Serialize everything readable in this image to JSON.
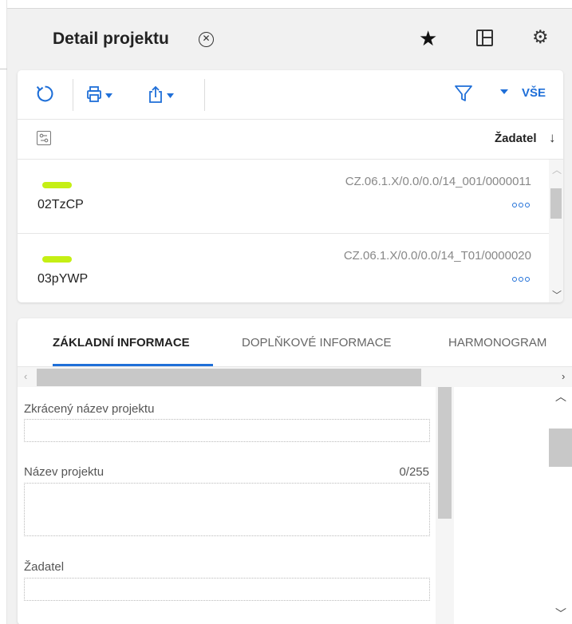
{
  "header": {
    "title": "Detail projektu",
    "close_icon": "close-circle-icon",
    "star_icon": "star-icon",
    "layout_icon": "layout-icon",
    "settings_icon": "gear-icon"
  },
  "toolbar": {
    "refresh_icon": "refresh-icon",
    "print_icon": "print-icon",
    "export_icon": "share-icon",
    "filter_icon": "filter-icon",
    "filter_selected": "VŠE",
    "accent_color": "#1f6fd8"
  },
  "sort": {
    "column_settings_icon": "column-settings-icon",
    "label": "Žadatel",
    "direction_arrow": "↓"
  },
  "projects": [
    {
      "code": "CZ.06.1.X/0.0/0.0/14_001/0000011",
      "name": "02TzCP",
      "status_color": "#c5ef14"
    },
    {
      "code": "CZ.06.1.X/0.0/0.0/14_T01/0000020",
      "name": "03pYWP",
      "status_color": "#c5ef14"
    }
  ],
  "tabs": [
    {
      "label": "ZÁKLADNÍ INFORMACE",
      "active": true
    },
    {
      "label": "DOPLŇKOVÉ INFORMACE",
      "active": false
    },
    {
      "label": "HARMONOGRAM",
      "active": false
    }
  ],
  "form": {
    "short_name_label": "Zkrácený název projektu",
    "short_name_value": "",
    "name_label": "Název projektu",
    "name_counter": "0/255",
    "name_value": "",
    "applicant_label": "Žadatel",
    "applicant_value": ""
  }
}
